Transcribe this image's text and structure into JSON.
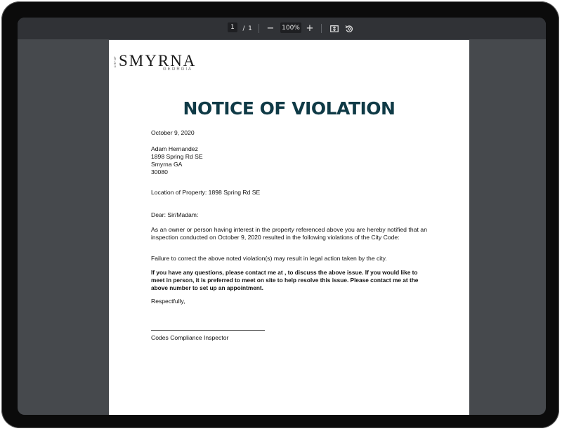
{
  "toolbar": {
    "page_current": "1",
    "page_sep": "/",
    "page_total": "1",
    "zoom_out": "−",
    "zoom_level": "100%",
    "zoom_in": "+",
    "fit_icon": "fit-page-icon",
    "rotate_icon": "rotate-icon"
  },
  "document": {
    "logo": {
      "city_of": "CITY OF",
      "name": "SMYRNA",
      "state": "GEORGIA"
    },
    "title": "NOTICE OF VIOLATION",
    "date": "October 9, 2020",
    "recipient": {
      "name": "Adam Hernandez",
      "street": "1898 Spring Rd SE",
      "city_state": "Smyrna GA",
      "zip": "30080"
    },
    "location": "Location of Property: 1898 Spring Rd SE",
    "salutation": "Dear: Sir/Madam:",
    "paragraph_1": "As an owner or person having interest in the property referenced  above you are hereby notified that an inspection conducted on October 9, 2020 resulted in the following violations of the City Code:",
    "paragraph_2": "Failure to correct the above noted violation(s) may result in legal action taken by the city.",
    "paragraph_3": "If you have any questions, please contact me at  , to discuss the above issue. If you would like to meet in person, it is preferred to meet  on site to help resolve this issue.  Please contact me at the above number to set up an appointment.",
    "closing": "Respectfully,",
    "signature_title": "Codes Compliance Inspector"
  }
}
